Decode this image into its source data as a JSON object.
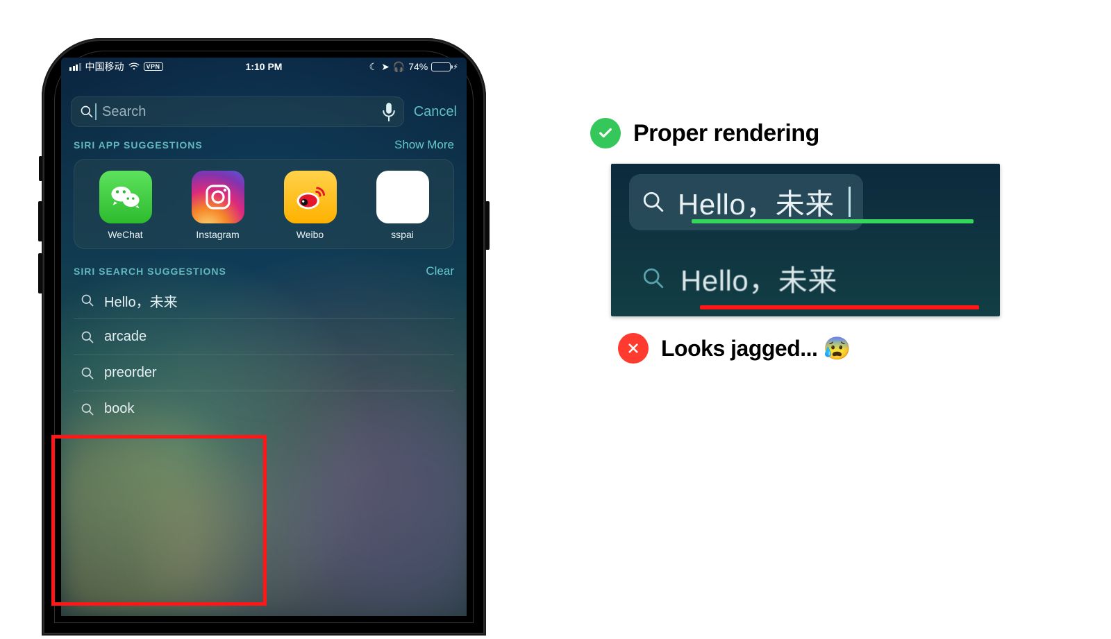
{
  "status": {
    "carrier": "中国移动",
    "vpn": "VPN",
    "time": "1:10 PM",
    "battery_pct": "74%"
  },
  "search": {
    "placeholder": "Search",
    "cancel": "Cancel"
  },
  "app_section": {
    "title": "SIRI APP SUGGESTIONS",
    "action": "Show More",
    "apps": [
      {
        "name": "WeChat"
      },
      {
        "name": "Instagram"
      },
      {
        "name": "Weibo"
      },
      {
        "name": "sspai"
      }
    ]
  },
  "search_section": {
    "title": "SIRI SEARCH SUGGESTIONS",
    "action": "Clear",
    "items": [
      "Hello，未来",
      "arcade",
      "preorder",
      "book"
    ]
  },
  "callout": {
    "good": "Proper rendering",
    "bad": "Looks jagged... 😰",
    "sample": "Hello，未来"
  }
}
